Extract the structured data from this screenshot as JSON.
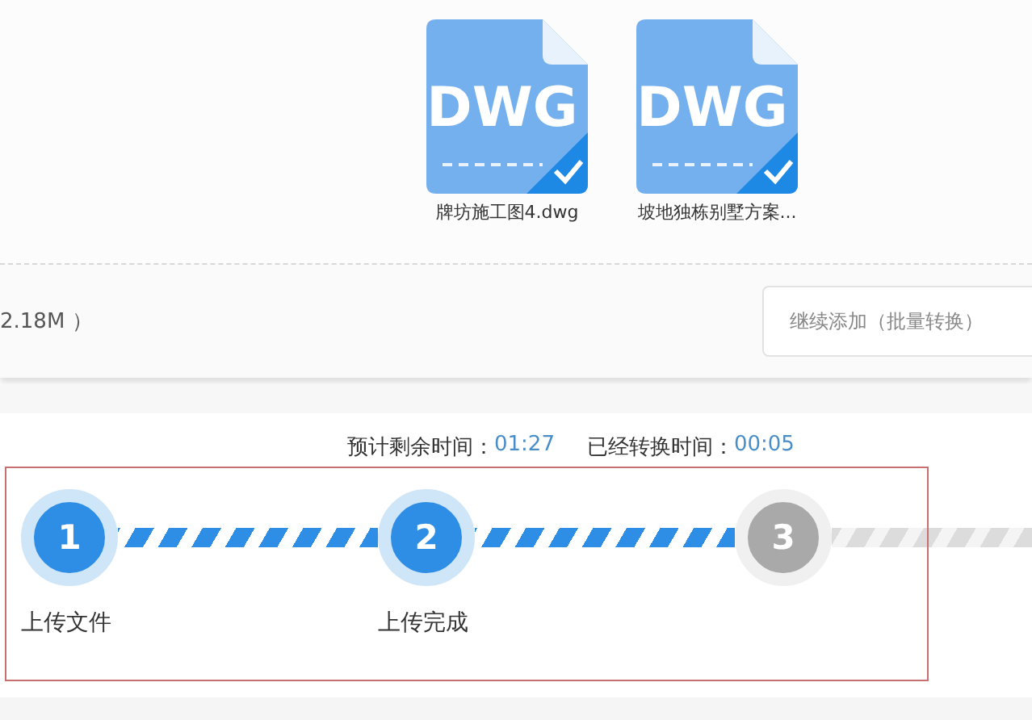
{
  "files": [
    {
      "icon_text": "DWG",
      "name": "牌坊施工图4.dwg",
      "checked": true
    },
    {
      "icon_text": "DWG",
      "name": "坡地独栋别墅方案...",
      "checked": true
    }
  ],
  "summary": {
    "size_text": "2.18M ）",
    "add_button": "继续添加（批量转换）"
  },
  "timing": {
    "remaining_label": "预计剩余时间：",
    "remaining": "01:27",
    "elapsed_label": "已经转换时间：",
    "elapsed": "00:05"
  },
  "steps": [
    {
      "number": "1",
      "label": "上传文件",
      "done": true
    },
    {
      "number": "2",
      "label": "上传完成",
      "done": true
    },
    {
      "number": "3",
      "done": false
    }
  ]
}
